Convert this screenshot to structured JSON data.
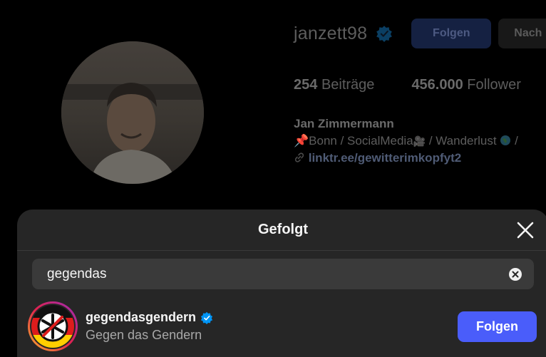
{
  "profile": {
    "username": "janzett98",
    "follow_label": "Folgen",
    "message_label": "Nach",
    "posts_count": "254",
    "posts_label": "Beiträge",
    "followers_count": "456.000",
    "followers_label": "Follower",
    "full_name": "Jan Zimmermann",
    "bio_line": "Bonn / SocialMedia",
    "bio_line_2": " / Wanderlust",
    "bio_tail": " /",
    "link": "linktr.ee/gewitterimkopfyt2"
  },
  "modal": {
    "title": "Gefolgt",
    "search": {
      "value": "gegendas"
    },
    "results": [
      {
        "username": "gegendasgendern",
        "subtitle": "Gegen das Gendern",
        "button_label": "Folgen"
      }
    ]
  },
  "colors": {
    "accent": "#4a5dfa",
    "verified": "#0095f6",
    "modal_bg": "#262626",
    "search_bg": "#3a3a3a"
  },
  "icons": {
    "verified": "verified-badge-icon",
    "close": "close-icon",
    "clear": "clear-search-icon",
    "pin": "pushpin-icon",
    "camera": "movie-camera-icon",
    "globe": "globe-icon",
    "link": "link-icon"
  }
}
